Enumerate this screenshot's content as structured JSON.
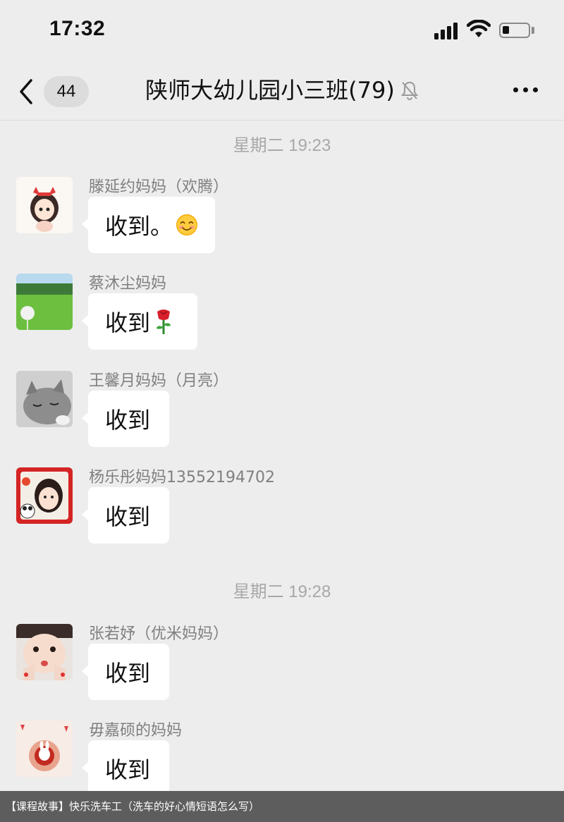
{
  "status_bar": {
    "time": "17:32"
  },
  "nav": {
    "unread_count": "44",
    "title": "陕师大幼儿园小三班(79)"
  },
  "timestamps": [
    "星期二 19:23",
    "星期二 19:28"
  ],
  "messages": [
    {
      "sender": "滕延约妈妈（欢腾）",
      "text": "收到。",
      "emoji": "smiling-face-emoji",
      "avatar": "cartoon-girl-avatar"
    },
    {
      "sender": "蔡沐尘妈妈",
      "text": "收到",
      "emoji": "rose-emoji",
      "avatar": "dandelion-field-avatar"
    },
    {
      "sender": "王馨月妈妈（月亮）",
      "text": "收到",
      "avatar": "sleeping-cat-avatar"
    },
    {
      "sender": "杨乐彤妈妈13552194702",
      "text": "收到",
      "avatar": "cartoon-woman-panda-avatar"
    },
    {
      "sender": "张若妤（优米妈妈）",
      "text": "收到",
      "avatar": "child-photo-avatar"
    },
    {
      "sender": "毋嘉硕的妈妈",
      "text": "收到",
      "avatar": "rabbit-cake-avatar"
    }
  ],
  "footer": {
    "caption": "【课程故事】快乐洗车工（洗车的好心情短语怎么写）"
  },
  "colors": {
    "background": "#ededed",
    "bubble": "#ffffff",
    "timestamp": "#a8a8a8",
    "sender_name": "#7f7f7f"
  }
}
